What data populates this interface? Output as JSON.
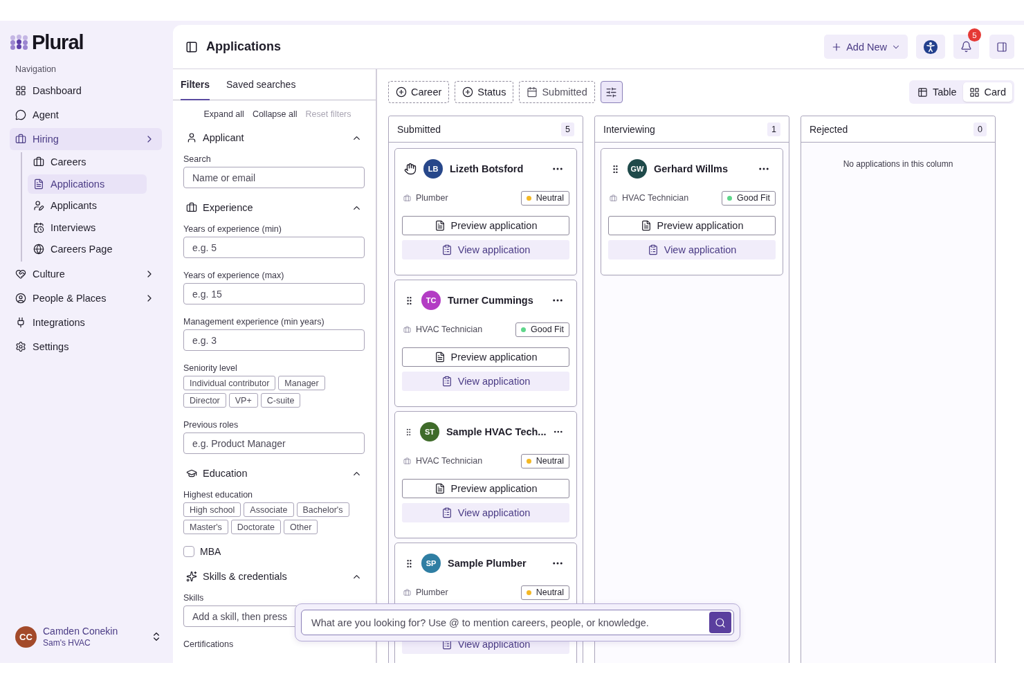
{
  "brand": {
    "name": "Plural"
  },
  "sidebar": {
    "section_label": "Navigation",
    "items": [
      {
        "label": "Dashboard",
        "selected": false,
        "expandable": false
      },
      {
        "label": "Agent",
        "selected": false,
        "expandable": false
      },
      {
        "label": "Hiring",
        "selected": true,
        "expandable": true,
        "children": [
          {
            "label": "Careers",
            "selected": false
          },
          {
            "label": "Applications",
            "selected": true
          },
          {
            "label": "Applicants",
            "selected": false
          },
          {
            "label": "Interviews",
            "selected": false
          },
          {
            "label": "Careers Page",
            "selected": false
          }
        ]
      },
      {
        "label": "Culture",
        "selected": false,
        "expandable": true
      },
      {
        "label": "People & Places",
        "selected": false,
        "expandable": true
      },
      {
        "label": "Integrations",
        "selected": false,
        "expandable": false
      },
      {
        "label": "Settings",
        "selected": false,
        "expandable": false
      }
    ]
  },
  "user": {
    "initials": "CC",
    "name": "Camden Conekin",
    "org": "Sam's HVAC"
  },
  "header": {
    "title": "Applications",
    "add_button": "Add New",
    "notification_count": "5"
  },
  "filters": {
    "tabs": [
      {
        "label": "Filters",
        "selected": true
      },
      {
        "label": "Saved searches",
        "selected": false
      }
    ],
    "actions": [
      {
        "label": "Expand all",
        "disabled": false
      },
      {
        "label": "Collapse all",
        "disabled": false
      },
      {
        "label": "Reset filters",
        "disabled": true
      }
    ],
    "sections": [
      {
        "title": "Applicant",
        "expanded": true,
        "fields": [
          {
            "kind": "input",
            "label": "Search",
            "placeholder": "Name or email"
          }
        ]
      },
      {
        "title": "Experience",
        "expanded": true,
        "fields": [
          {
            "kind": "input",
            "label": "Years of experience (min)",
            "placeholder": "e.g. 5"
          },
          {
            "kind": "input",
            "label": "Years of experience (max)",
            "placeholder": "e.g. 15"
          },
          {
            "kind": "input",
            "label": "Management experience (min years)",
            "placeholder": "e.g. 3"
          },
          {
            "kind": "chips",
            "label": "Seniority level",
            "options": [
              {
                "label": "Individual contributor",
                "selected": false
              },
              {
                "label": "Manager",
                "selected": false
              },
              {
                "label": "Director",
                "selected": false
              },
              {
                "label": "VP+",
                "selected": false
              },
              {
                "label": "C-suite",
                "selected": false
              }
            ]
          },
          {
            "kind": "input",
            "label": "Previous roles",
            "placeholder": "e.g. Product Manager"
          }
        ]
      },
      {
        "title": "Education",
        "expanded": true,
        "fields": [
          {
            "kind": "chips",
            "label": "Highest education",
            "options": [
              {
                "label": "High school",
                "selected": false
              },
              {
                "label": "Associate",
                "selected": false
              },
              {
                "label": "Bachelor's",
                "selected": false
              },
              {
                "label": "Master's",
                "selected": false
              },
              {
                "label": "Doctorate",
                "selected": false
              },
              {
                "label": "Other",
                "selected": false
              }
            ]
          },
          {
            "kind": "checkbox",
            "label": "MBA",
            "checked": false
          }
        ]
      },
      {
        "title": "Skills & credentials",
        "expanded": true,
        "fields": [
          {
            "kind": "input",
            "label": "Skills",
            "placeholder": "Add a skill, then press"
          },
          {
            "kind": "label",
            "label": "Certifications"
          }
        ]
      }
    ]
  },
  "board": {
    "chips": [
      {
        "kind": "add",
        "label": "Career"
      },
      {
        "kind": "add",
        "label": "Status"
      },
      {
        "kind": "date",
        "label": "Submitted"
      }
    ],
    "view_toggle": [
      {
        "label": "Table",
        "selected": false
      },
      {
        "label": "Card",
        "selected": true
      }
    ],
    "columns": [
      {
        "title": "Submitted",
        "count": "5",
        "cards": [
          {
            "kind": "hand",
            "avatar": {
              "initials": "LB",
              "color": "#27478a"
            },
            "name": "Lizeth Botsford",
            "role": "Plumber",
            "fit": {
              "label": "Neutral",
              "color": "#f4b824"
            },
            "actions": [
              {
                "kind": "preview",
                "label": "Preview application"
              },
              {
                "kind": "view",
                "label": "View application"
              }
            ]
          },
          {
            "kind": "grip",
            "avatar": {
              "initials": "TC",
              "color": "#b33cc4"
            },
            "name": "Turner Cummings",
            "role": "HVAC Technician",
            "fit": {
              "label": "Good Fit",
              "color": "#5fd68b"
            },
            "actions": [
              {
                "kind": "preview",
                "label": "Preview application"
              },
              {
                "kind": "view",
                "label": "View application"
              }
            ]
          },
          {
            "kind": "grip",
            "avatar": {
              "initials": "ST",
              "color": "#3f6b2a"
            },
            "name": "Sample HVAC Tech...",
            "role": "HVAC Technician",
            "fit": {
              "label": "Neutral",
              "color": "#f4b824"
            },
            "actions": [
              {
                "kind": "preview",
                "label": "Preview application"
              },
              {
                "kind": "view",
                "label": "View application"
              }
            ]
          },
          {
            "kind": "grip",
            "avatar": {
              "initials": "SP",
              "color": "#2f7ea3"
            },
            "name": "Sample Plumber",
            "role": "Plumber",
            "fit": {
              "label": "Neutral",
              "color": "#f4b824"
            },
            "actions": [
              {
                "kind": "view",
                "label": "View application"
              }
            ]
          }
        ]
      },
      {
        "title": "Interviewing",
        "count": "1",
        "cards": [
          {
            "kind": "grip",
            "avatar": {
              "initials": "GW",
              "color": "#1f4a4a"
            },
            "name": "Gerhard Willms",
            "role": "HVAC Technician",
            "fit": {
              "label": "Good Fit",
              "color": "#5fd68b"
            },
            "actions": [
              {
                "kind": "preview",
                "label": "Preview application"
              },
              {
                "kind": "view",
                "label": "View application"
              }
            ]
          }
        ]
      },
      {
        "title": "Rejected",
        "count": "0",
        "empty_text": "No applications in this column"
      }
    ]
  },
  "assistant": {
    "placeholder": "What are you looking for? Use @ to mention careers, people, or knowledge."
  }
}
